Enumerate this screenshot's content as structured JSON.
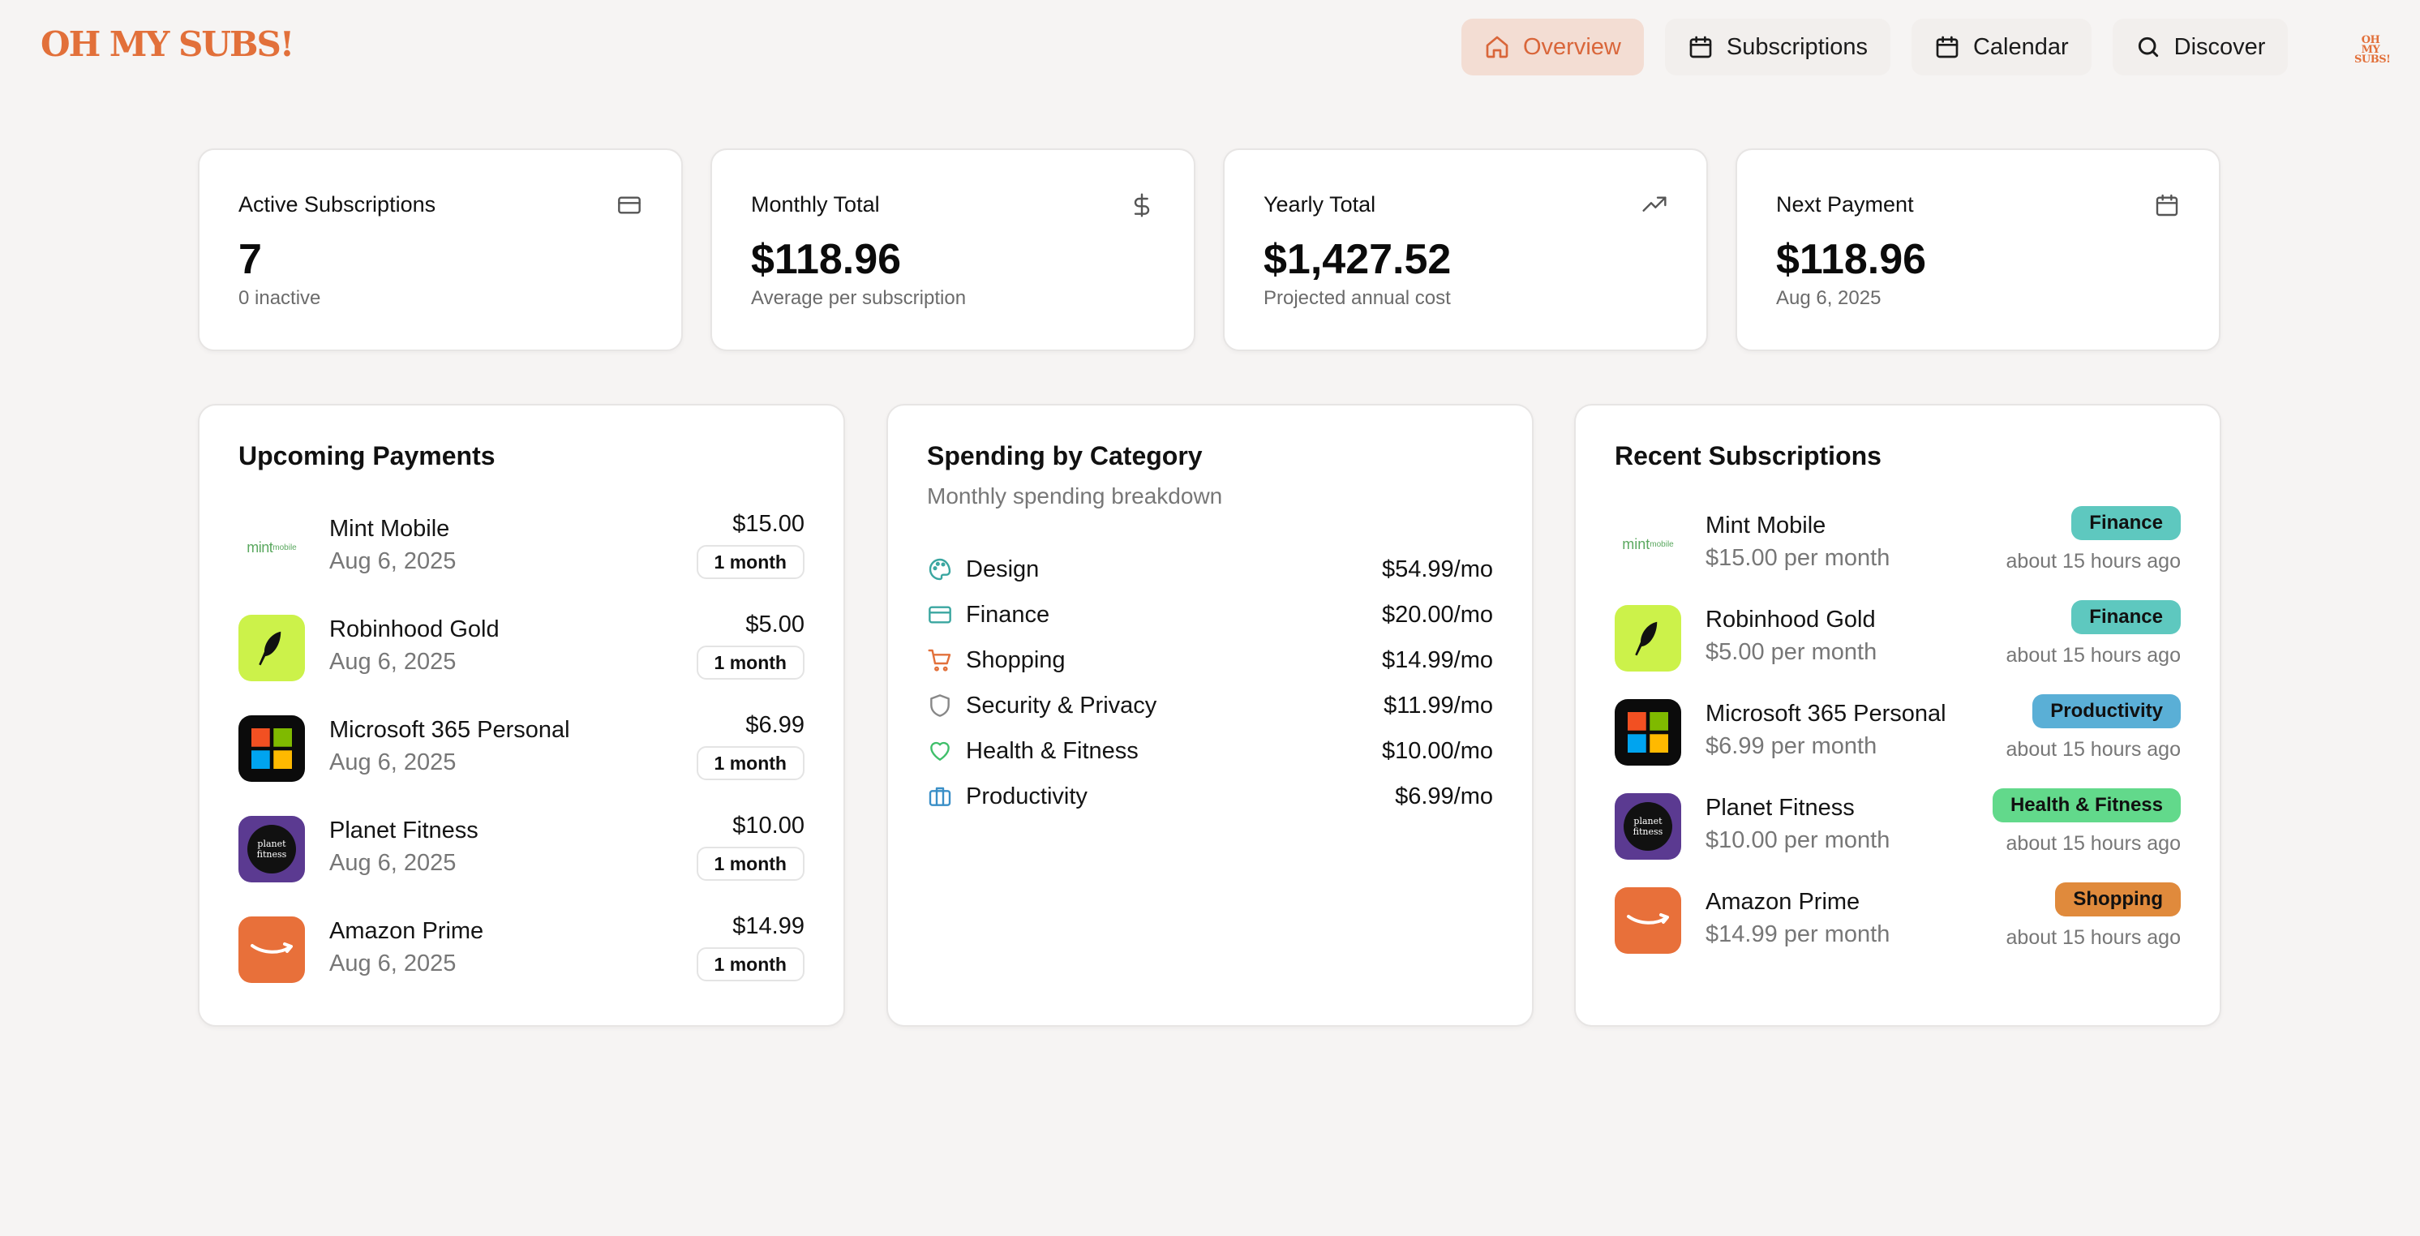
{
  "brand": {
    "name": "OH MY SUBS!",
    "small_line1": "OH MY",
    "small_line2": "SUBS!"
  },
  "nav": [
    {
      "label": "Overview",
      "icon": "home-icon",
      "active": true
    },
    {
      "label": "Subscriptions",
      "icon": "calendar-icon",
      "active": false
    },
    {
      "label": "Calendar",
      "icon": "calendar-icon",
      "active": false
    },
    {
      "label": "Discover",
      "icon": "search-icon",
      "active": false
    }
  ],
  "stats": [
    {
      "title": "Active Subscriptions",
      "value": "7",
      "sub": "0 inactive",
      "icon": "credit-card-icon"
    },
    {
      "title": "Monthly Total",
      "value": "$118.96",
      "sub": "Average per subscription",
      "icon": "dollar-icon"
    },
    {
      "title": "Yearly Total",
      "value": "$1,427.52",
      "sub": "Projected annual cost",
      "icon": "trending-up-icon"
    },
    {
      "title": "Next Payment",
      "value": "$118.96",
      "sub": "Aug 6, 2025",
      "icon": "calendar-icon"
    }
  ],
  "upcoming": {
    "title": "Upcoming Payments",
    "items": [
      {
        "name": "Mint Mobile",
        "date": "Aug 6, 2025",
        "amount": "$15.00",
        "cycle": "1 month",
        "logo": "mint-mobile-logo"
      },
      {
        "name": "Robinhood Gold",
        "date": "Aug 6, 2025",
        "amount": "$5.00",
        "cycle": "1 month",
        "logo": "robinhood-logo"
      },
      {
        "name": "Microsoft 365 Personal",
        "date": "Aug 6, 2025",
        "amount": "$6.99",
        "cycle": "1 month",
        "logo": "microsoft-logo"
      },
      {
        "name": "Planet Fitness",
        "date": "Aug 6, 2025",
        "amount": "$10.00",
        "cycle": "1 month",
        "logo": "planet-fitness-logo"
      },
      {
        "name": "Amazon Prime",
        "date": "Aug 6, 2025",
        "amount": "$14.99",
        "cycle": "1 month",
        "logo": "amazon-logo"
      }
    ]
  },
  "spending": {
    "title": "Spending by Category",
    "subtitle": "Monthly spending breakdown",
    "items": [
      {
        "name": "Design",
        "value": "$54.99/mo",
        "icon": "palette-icon",
        "color": "#3aa6a0"
      },
      {
        "name": "Finance",
        "value": "$20.00/mo",
        "icon": "credit-card-icon",
        "color": "#3aa6a0"
      },
      {
        "name": "Shopping",
        "value": "$14.99/mo",
        "icon": "cart-icon",
        "color": "#e2703a"
      },
      {
        "name": "Security & Privacy",
        "value": "$11.99/mo",
        "icon": "shield-icon",
        "color": "#888888"
      },
      {
        "name": "Health & Fitness",
        "value": "$10.00/mo",
        "icon": "heart-icon",
        "color": "#3fbf6a"
      },
      {
        "name": "Productivity",
        "value": "$6.99/mo",
        "icon": "briefcase-icon",
        "color": "#3a8fc7"
      }
    ]
  },
  "recent": {
    "title": "Recent Subscriptions",
    "items": [
      {
        "name": "Mint Mobile",
        "price": "$15.00 per month",
        "tag": "Finance",
        "tag_color": "#5ec8bf",
        "ago": "about 15 hours ago",
        "logo": "mint-mobile-logo"
      },
      {
        "name": "Robinhood Gold",
        "price": "$5.00 per month",
        "tag": "Finance",
        "tag_color": "#5ec8bf",
        "ago": "about 15 hours ago",
        "logo": "robinhood-logo"
      },
      {
        "name": "Microsoft 365 Personal",
        "price": "$6.99 per month",
        "tag": "Productivity",
        "tag_color": "#5aafd6",
        "ago": "about 15 hours ago",
        "logo": "microsoft-logo"
      },
      {
        "name": "Planet Fitness",
        "price": "$10.00 per month",
        "tag": "Health & Fitness",
        "tag_color": "#62d98b",
        "ago": "about 15 hours ago",
        "logo": "planet-fitness-logo"
      },
      {
        "name": "Amazon Prime",
        "price": "$14.99 per month",
        "tag": "Shopping",
        "tag_color": "#e08a3c",
        "ago": "about 15 hours ago",
        "logo": "amazon-logo"
      }
    ]
  },
  "logo_text": {
    "mint": "mint",
    "mint_small": "mobile",
    "pf_line1": "planet",
    "pf_line2": "fitness"
  }
}
